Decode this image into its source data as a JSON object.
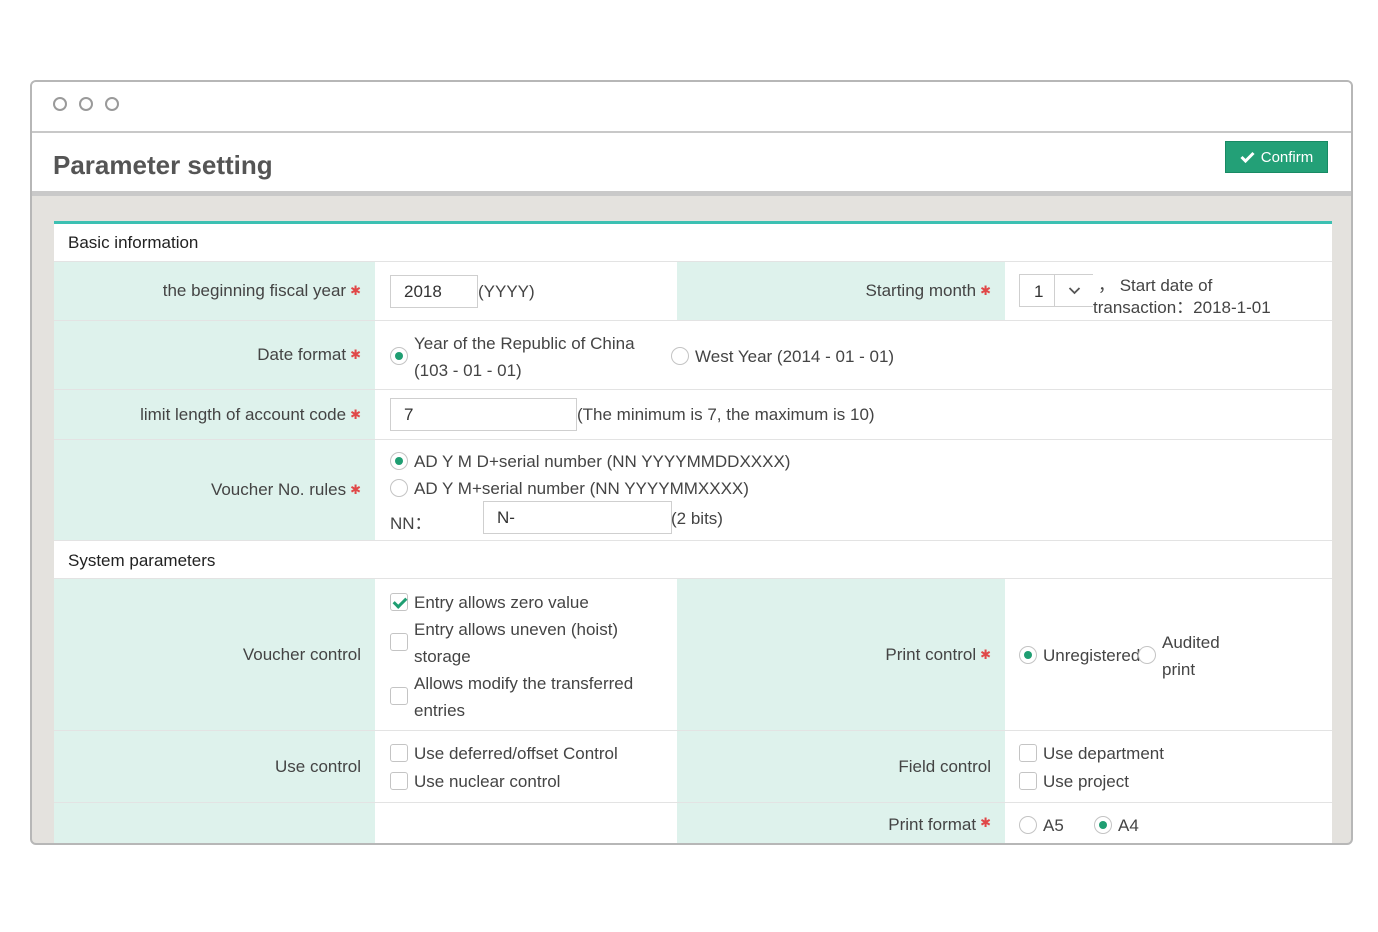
{
  "header": {
    "title": "Parameter setting",
    "confirm_label": "Confirm"
  },
  "sections": {
    "basic": "Basic information",
    "system": "System parameters"
  },
  "fiscal_year": {
    "label": "the beginning fiscal year",
    "value": "2018",
    "hint": "(YYYY)"
  },
  "starting_month": {
    "label": "Starting month",
    "value": "1",
    "note_line1": "， Start date of",
    "note_line2": "transaction：2018-1-01"
  },
  "date_format": {
    "label": "Date format",
    "opt1_line1": "Year of the Republic of China",
    "opt1_line2": "(103 - 01 - 01)",
    "opt2": "West Year (2014 - 01 - 01)"
  },
  "account_code": {
    "label": "limit length of account code",
    "value": "7",
    "hint": "(The minimum is 7, the maximum is 10)"
  },
  "voucher_rules": {
    "label": "Voucher No. rules",
    "opt1": "AD Y M D+serial number (NN YYYYMMDDXXXX)",
    "opt2": "AD Y M+serial number (NN YYYYMMXXXX)",
    "nn_label": "NN：",
    "nn_value": "N-",
    "nn_hint": "(2 bits)"
  },
  "voucher_control": {
    "label": "Voucher control",
    "opt1": "Entry allows zero value",
    "opt2_line1": "Entry allows uneven (hoist)",
    "opt2_line2": "storage",
    "opt3_line1": "Allows modify the transferred",
    "opt3_line2": "entries"
  },
  "print_control": {
    "label": "Print control",
    "opt1": "Unregistered",
    "opt2_line1": "Audited",
    "opt2_line2": "print"
  },
  "use_control": {
    "label": "Use control",
    "opt1": "Use deferred/offset Control",
    "opt2": "Use nuclear control"
  },
  "field_control": {
    "label": "Field control",
    "opt1": "Use department",
    "opt2": "Use project"
  },
  "print_format": {
    "label": "Print format",
    "opt1": "A5",
    "opt2": "A4"
  },
  "colors": {
    "accent": "#23a077",
    "label_bg": "#def2ec",
    "panel_top": "#3cc0b2",
    "required": "#e04848"
  }
}
